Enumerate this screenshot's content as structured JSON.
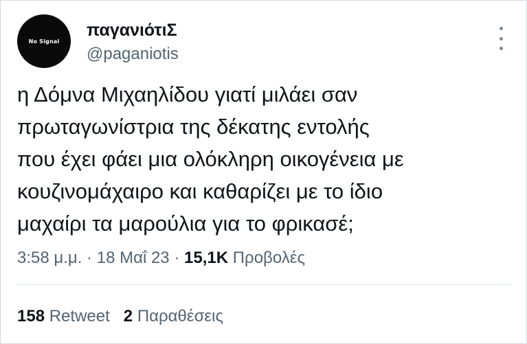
{
  "tweet": {
    "avatar_text": "No Signal",
    "display_name": "παγανιότιΣ",
    "handle": "@paganiotis",
    "text": "η Δόμνα Μιχαηλίδου γιατί μιλάει σαν\nπρωταγωνίστρια της δέκατης εντολής\nπου έχει φάει μια ολόκληρη οικογένεια με\nκουζινομάχαιρο και καθαρίζει με το ίδιο\nμαχαίρι τα μαρούλια για το φρικασέ;",
    "time": "3:58 μ.μ.",
    "separator": "·",
    "date": "18 Μαΐ 23",
    "views_count": "15,1K",
    "views_label": "Προβολές"
  },
  "stats": {
    "retweets_count": "158",
    "retweets_label": "Retweet",
    "quotes_count": "2",
    "quotes_label": "Παραθέσεις"
  },
  "icons": {
    "more": "more-vertical-icon"
  },
  "colors": {
    "text_primary": "#0f1419",
    "text_secondary": "#536471",
    "avatar_bg": "#0a0a0a",
    "border": "#cfd9de"
  }
}
